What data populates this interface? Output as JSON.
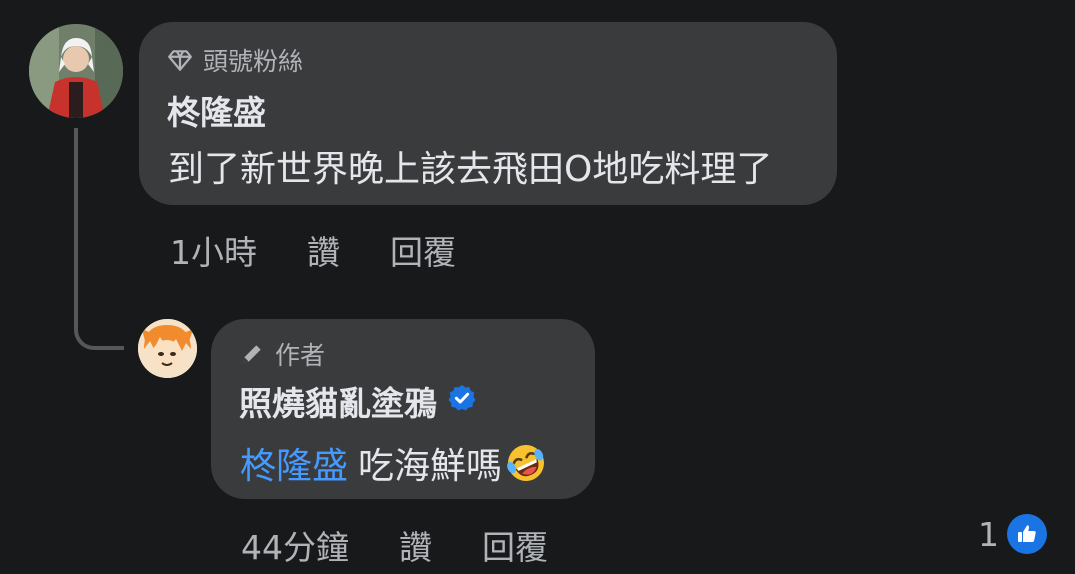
{
  "comments": [
    {
      "badge": "頭號粉絲",
      "author": "柊隆盛",
      "text": "到了新世界晚上該去飛田O地吃料理了",
      "time": "1小時",
      "like_label": "讚",
      "reply_label": "回覆"
    },
    {
      "badge": "作者",
      "author": "照燒貓亂塗鴉",
      "verified": true,
      "mention": "柊隆盛",
      "text": "吃海鮮嗎",
      "emoji": "rolling-on-floor-laughing",
      "time": "44分鐘",
      "like_label": "讚",
      "reply_label": "回覆",
      "reaction_count": "1"
    }
  ],
  "colors": {
    "background": "#18191a",
    "bubble": "#3a3b3c",
    "mention": "#4599ff",
    "verified": "#1b74e4",
    "secondary_text": "#b0b3b8"
  },
  "icons": {
    "top_fan_badge": "diamond-icon",
    "author_badge": "pencil-icon",
    "verified": "verified-badge-icon",
    "reaction": "thumbs-up-icon"
  }
}
